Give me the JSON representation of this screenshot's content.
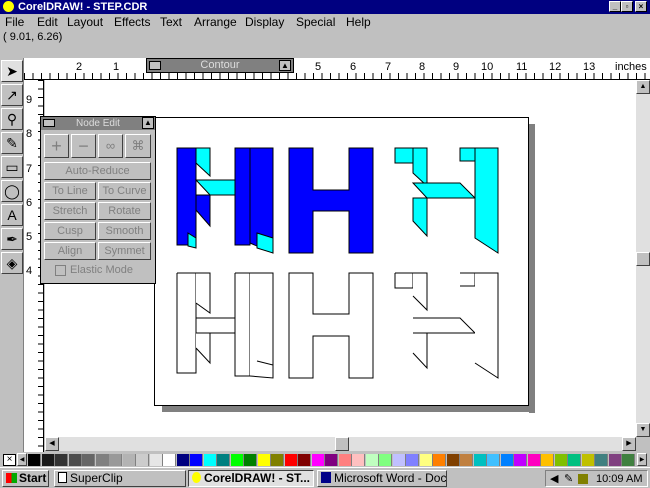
{
  "window": {
    "title": "CorelDRAW! - STEP.CDR"
  },
  "menu": [
    "File",
    "Edit",
    "Layout",
    "Effects",
    "Text",
    "Arrange",
    "Display",
    "Special",
    "Help"
  ],
  "status": {
    "coords": "( 9.01,  6.26)"
  },
  "ruler": {
    "h_labels": [
      "2",
      "1",
      "5",
      "6",
      "7",
      "8",
      "9",
      "10",
      "11",
      "12",
      "13"
    ],
    "unit": "inches",
    "v_labels": [
      "9",
      "8",
      "7",
      "6",
      "5",
      "4"
    ]
  },
  "contour": {
    "title": "Contour"
  },
  "nodeedit": {
    "title": "Node Edit",
    "buttons": [
      "Auto-Reduce",
      "To Line",
      "To Curve",
      "Stretch",
      "Rotate",
      "Cusp",
      "Smooth",
      "Align",
      "Symmet"
    ],
    "elastic": "Elastic Mode"
  },
  "colors": {
    "blue": "#0000ff",
    "cyan": "#00ffff",
    "navy": "#000080",
    "palette": [
      "#000000",
      "#1a1a1a",
      "#333333",
      "#4d4d4d",
      "#666666",
      "#808080",
      "#999999",
      "#b3b3b3",
      "#cccccc",
      "#e6e6e6",
      "#ffffff",
      "#000080",
      "#0000ff",
      "#00ffff",
      "#008080",
      "#00ff00",
      "#008000",
      "#ffff00",
      "#808000",
      "#ff0000",
      "#800000",
      "#ff00ff",
      "#800080",
      "#ff8080",
      "#ffc0c0",
      "#c0ffc0",
      "#80ff80",
      "#c0c0ff",
      "#8080ff",
      "#ffff80",
      "#ff8000",
      "#804000",
      "#c08040",
      "#00c0c0",
      "#40c0ff",
      "#0080ff",
      "#c000ff",
      "#ff00c0",
      "#ffc000",
      "#80c000",
      "#00c080",
      "#c0c000",
      "#408080",
      "#804080",
      "#408040"
    ]
  },
  "taskbar": {
    "start": "Start",
    "tasks": [
      "SuperClip",
      "CorelDRAW! - ST...",
      "Microsoft Word - Doc..."
    ],
    "clock": "10:09 AM"
  }
}
